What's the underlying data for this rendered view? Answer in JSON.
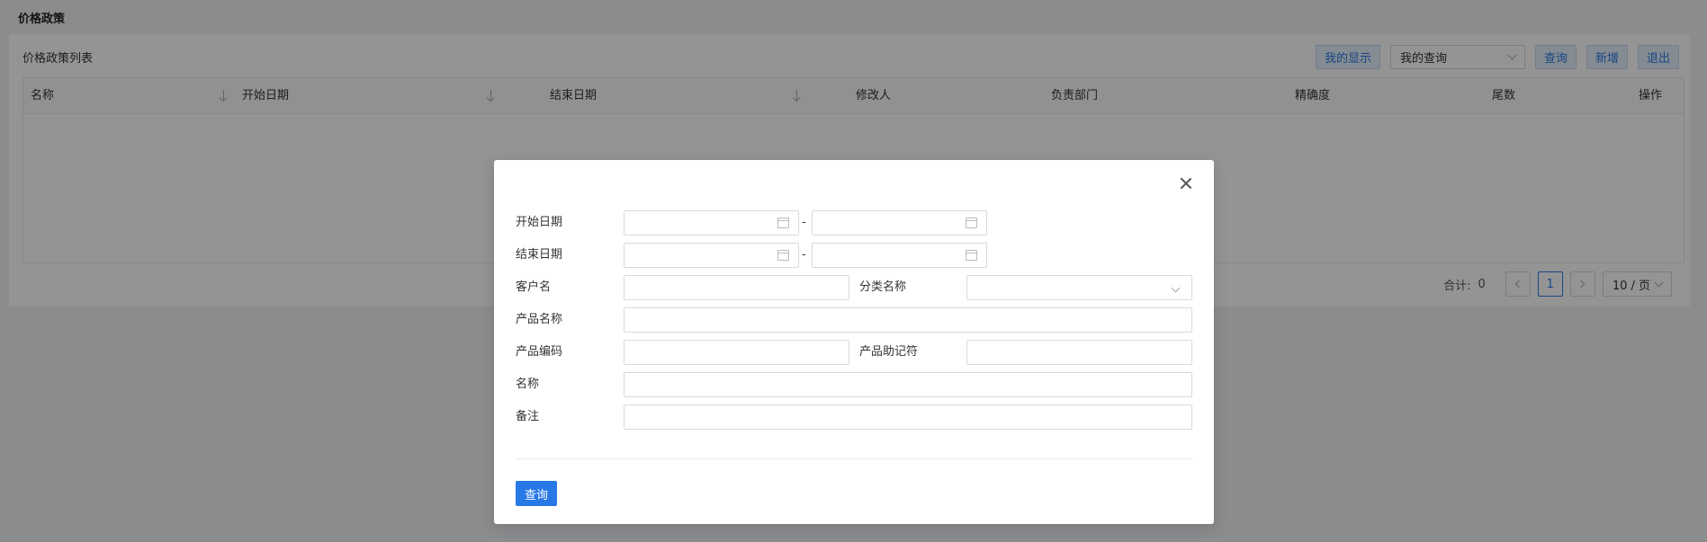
{
  "page": {
    "title": "价格政策"
  },
  "panel": {
    "title": "价格政策列表"
  },
  "toolbar": {
    "my_display": "我的显示",
    "my_query_select": "我的查询",
    "query": "查询",
    "add": "新增",
    "exit": "退出"
  },
  "table": {
    "columns": [
      "名称",
      "开始日期",
      "结束日期",
      "修改人",
      "负责部门",
      "精确度",
      "尾数",
      "操作"
    ]
  },
  "pager": {
    "total_label": "合计:",
    "total": "0",
    "current_page": "1",
    "page_size": "10 / 页"
  },
  "modal": {
    "labels": {
      "start_date": "开始日期",
      "end_date": "结束日期",
      "customer_name": "客户名",
      "category_name": "分类名称",
      "product_name": "产品名称",
      "product_code": "产品编码",
      "product_mnemonic": "产品助记符",
      "name": "名称",
      "remark": "备注"
    },
    "range_separator": "-",
    "query_button": "查询"
  },
  "colors": {
    "primary": "#2878e6",
    "light_button_bg": "#e6f0fc"
  }
}
